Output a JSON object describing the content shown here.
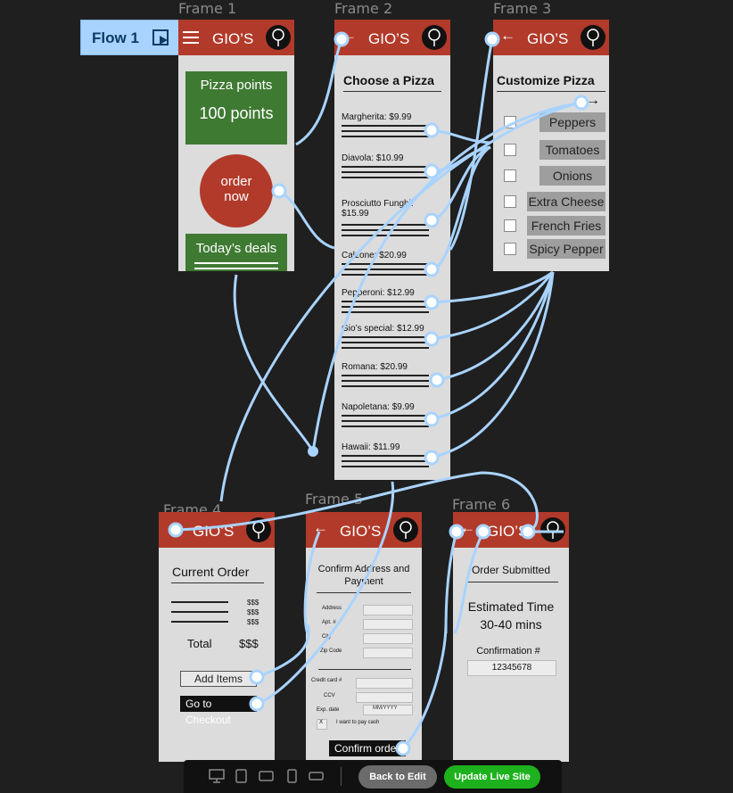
{
  "flow": {
    "label": "Flow 1"
  },
  "frames": {
    "f1": {
      "label": "Frame 1",
      "title": "GIO’S",
      "points_title": "Pizza points",
      "points_value": "100 points",
      "order_line1": "order",
      "order_line2": "now",
      "deals": "Today’s deals"
    },
    "f2": {
      "label": "Frame 2",
      "title": "GIO’S",
      "heading": "Choose a Pizza",
      "items": [
        {
          "name": "Margherita: $9.99"
        },
        {
          "name": "Diavola: $10.99"
        },
        {
          "name": "Prosciutto Funghi: $15.99"
        },
        {
          "name": "Calzone: $20.99"
        },
        {
          "name": "Pepperoni: $12.99"
        },
        {
          "name": "Gio’s special: $12.99"
        },
        {
          "name": "Romana: $20.99"
        },
        {
          "name": "Napoletana: $9.99"
        },
        {
          "name": "Hawaii: $11.99"
        }
      ]
    },
    "f3": {
      "label": "Frame 3",
      "title": "GIO’S",
      "heading": "Customize Pizza",
      "options": [
        "Peppers",
        "Tomatoes",
        "Onions",
        "Extra Cheese",
        "French Fries",
        "Spicy Pepper"
      ]
    },
    "f4": {
      "label": "Frame 4",
      "title": "GIO’S",
      "heading": "Current Order",
      "prices": [
        "$$$",
        "$$$",
        "$$$"
      ],
      "total_label": "Total",
      "total_value": "$$$",
      "add_items": "Add Items",
      "checkout": "Go to Checkout"
    },
    "f5": {
      "label": "Frame 5",
      "title": "GIO’S",
      "heading_line1": "Confirm Address and",
      "heading_line2": "Payment",
      "address_fields": [
        "Address",
        "Apt. #",
        "City",
        "Zip Code"
      ],
      "card_label": "Credit card #",
      "ccv_label": "CCV",
      "exp_label": "Exp. date",
      "exp_placeholder": "MM/YYYY",
      "cash_mark": "X",
      "cash_label": "I want to pay cash",
      "confirm": "Confirm order"
    },
    "f6": {
      "label": "Frame 6",
      "title": "GIO’S",
      "heading": "Order Submitted",
      "est_line1": "Estimated Time",
      "est_line2": "30-40 mins",
      "conf_label": "Confirmation #",
      "conf_value": "12345678"
    }
  },
  "toolbar": {
    "back_label": "Back to Edit",
    "update_label": "Update Live Site",
    "devices": [
      "desktop-icon",
      "tablet-icon",
      "tablet-landscape-icon",
      "phone-icon",
      "phone-landscape-icon"
    ]
  },
  "colors": {
    "header": "#b23a2a",
    "green": "#3f7a33",
    "wire": "#a9d3ff",
    "update": "#1db11d"
  }
}
